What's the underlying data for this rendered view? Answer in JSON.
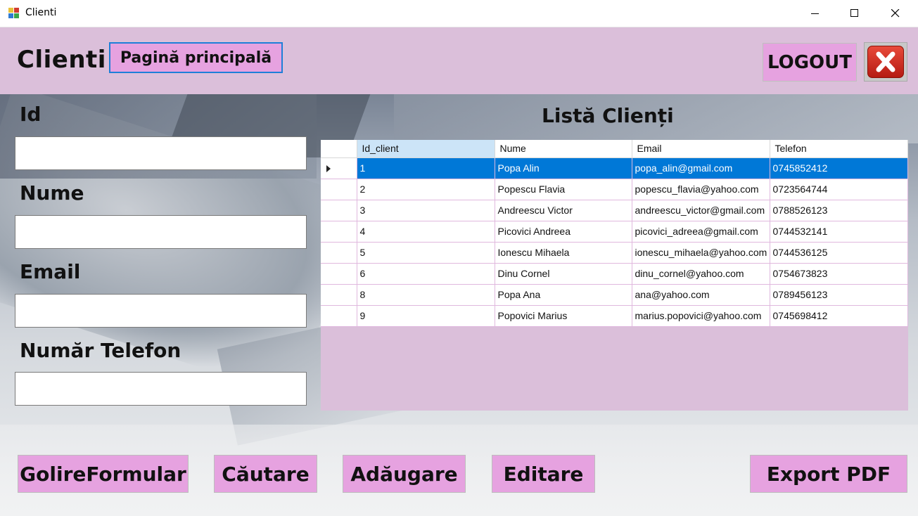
{
  "window": {
    "title": "Clienti"
  },
  "header": {
    "title": "Clienti",
    "home_label": "Pagină principală",
    "logout_label": "LOGOUT"
  },
  "form": {
    "id_label": "Id",
    "name_label": "Nume",
    "email_label": "Email",
    "phone_label": "Număr Telefon",
    "id_value": "",
    "name_value": "",
    "email_value": "",
    "phone_value": ""
  },
  "grid": {
    "title": "Listă Clienți",
    "columns": [
      "Id_client",
      "Nume",
      "Email",
      "Telefon"
    ],
    "selected_row": 0,
    "rows": [
      {
        "id": "1",
        "nume": "Popa Alin",
        "email": "popa_alin@gmail.com",
        "telefon": "0745852412"
      },
      {
        "id": "2",
        "nume": "Popescu Flavia",
        "email": "popescu_flavia@yahoo.com",
        "telefon": "0723564744"
      },
      {
        "id": "3",
        "nume": "Andreescu Victor",
        "email": "andreescu_victor@gmail.com",
        "telefon": "0788526123"
      },
      {
        "id": "4",
        "nume": "Picovici Andreea",
        "email": "picovici_adreea@gmail.com",
        "telefon": "0744532141"
      },
      {
        "id": "5",
        "nume": "Ionescu Mihaela",
        "email": "ionescu_mihaela@yahoo.com",
        "telefon": "0744536125"
      },
      {
        "id": "6",
        "nume": "Dinu Cornel",
        "email": "dinu_cornel@yahoo.com",
        "telefon": "0754673823"
      },
      {
        "id": "8",
        "nume": "Popa Ana",
        "email": "ana@yahoo.com",
        "telefon": "0789456123"
      },
      {
        "id": "9",
        "nume": "Popovici Marius",
        "email": "marius.popovici@yahoo.com",
        "telefon": "0745698412"
      }
    ]
  },
  "actions": {
    "clear_label": "GolireFormular",
    "search_label": "Căutare",
    "add_label": "Adăugare",
    "edit_label": "Editare",
    "export_label": "Export PDF"
  },
  "colors": {
    "header_bg": "#dbbfda",
    "button_bg": "#e6a2e0",
    "selection": "#0078d7",
    "close_red": "#d3261b"
  }
}
